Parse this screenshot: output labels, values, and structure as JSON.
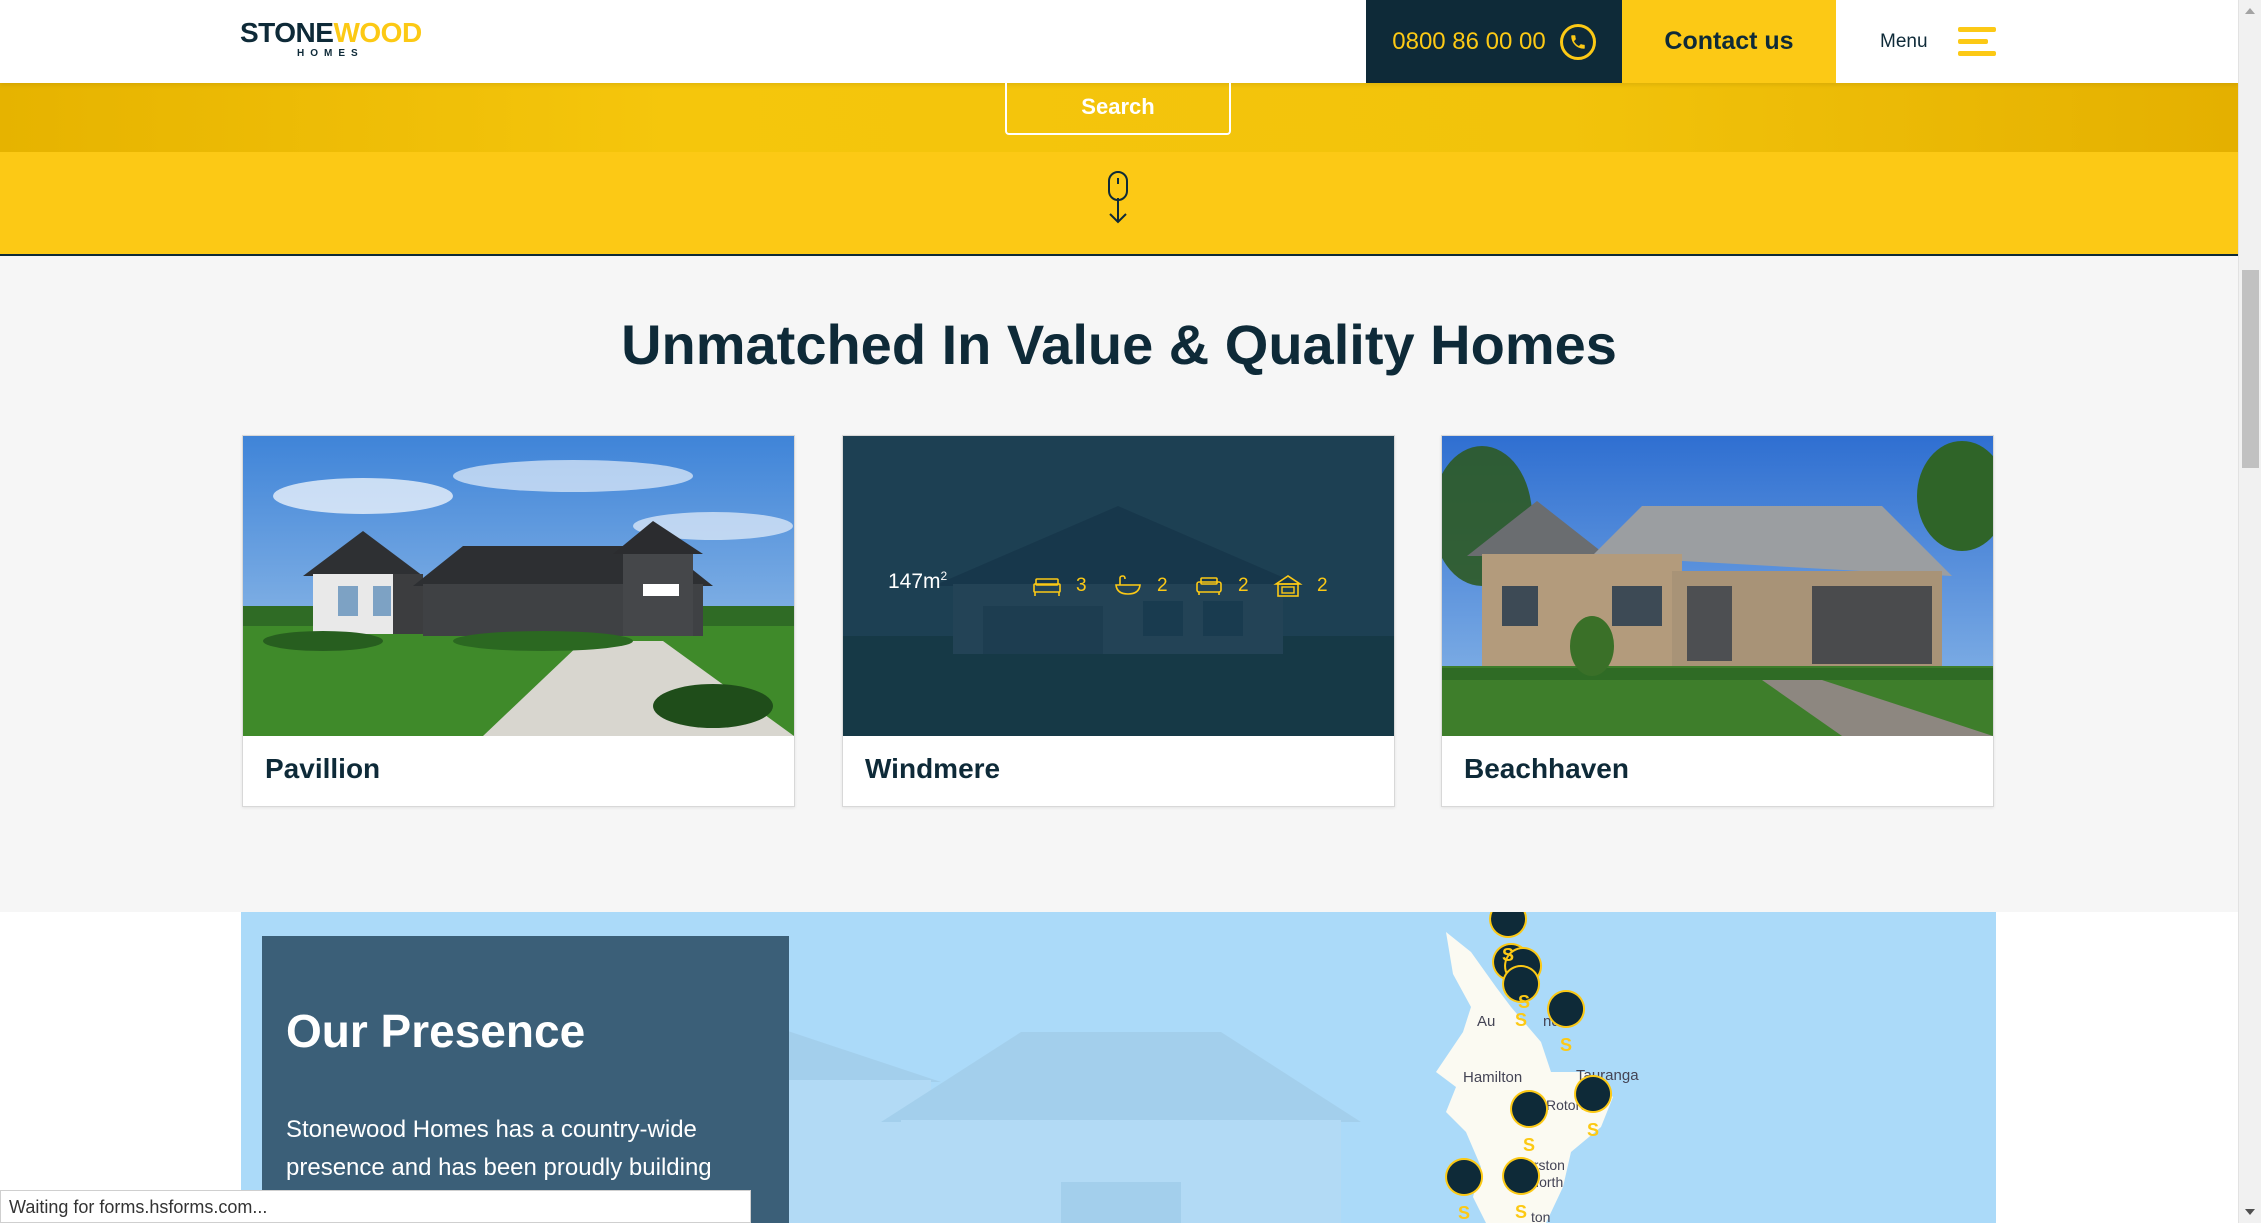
{
  "header": {
    "logo_main_a": "STONE",
    "logo_main_b": "WOOD",
    "logo_sub": "HOMES",
    "phone": "0800 86 00 00",
    "contact_label": "Contact us",
    "menu_label": "Menu"
  },
  "hero": {
    "search_label": "Search"
  },
  "section": {
    "title": "Unmatched In Value & Quality Homes"
  },
  "cards": [
    {
      "name": "Pavillion"
    },
    {
      "name": "Windmere",
      "area": "147m",
      "area_sup": "2",
      "bedrooms": "3",
      "bathrooms": "2",
      "living": "2",
      "garage": "2"
    },
    {
      "name": "Beachhaven"
    }
  ],
  "presence": {
    "title": "Our Presence",
    "text": "Stonewood Homes has a country-wide presence and has been proudly building",
    "map_labels": [
      "Au",
      "nd",
      "Hamilton",
      "Tauranga",
      "Rotoru",
      "P",
      "erston",
      "North",
      "ton"
    ]
  },
  "status_bar": {
    "text": "Waiting for forms.hsforms.com..."
  },
  "colors": {
    "brand_yellow": "#fcc915",
    "brand_navy": "#0e2a38",
    "presence_panel": "#3b5f78",
    "map_water": "#abdaf9"
  }
}
